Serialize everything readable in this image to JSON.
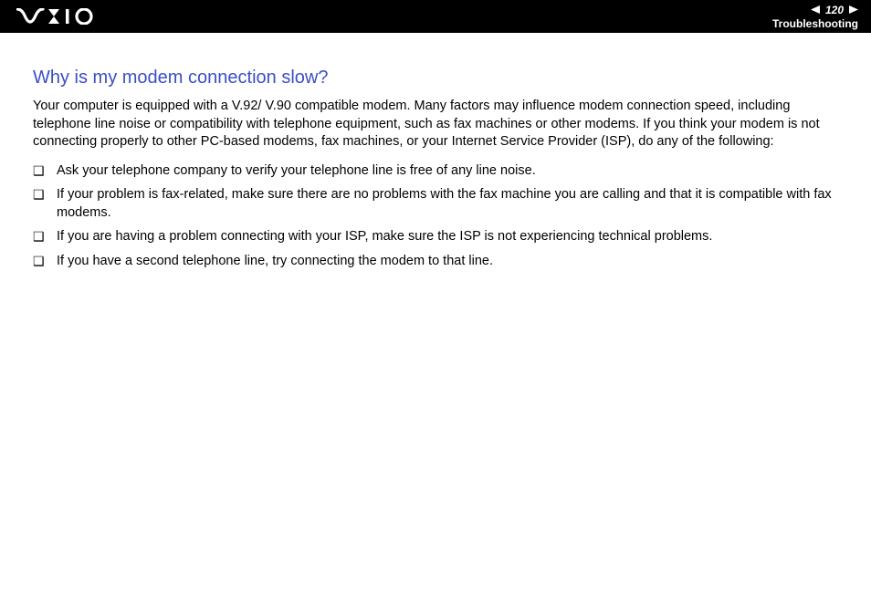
{
  "header": {
    "page_number": "120",
    "section": "Troubleshooting"
  },
  "content": {
    "heading": "Why is my modem connection slow?",
    "intro": "Your computer is equipped with a V.92/ V.90 compatible modem. Many factors may influence modem connection speed, including telephone line noise or compatibility with telephone equipment, such as fax machines or other modems. If you think your modem is not connecting properly to other PC-based modems, fax machines, or your Internet Service Provider (ISP), do any of the following:",
    "bullets": [
      "Ask your telephone company to verify your telephone line is free of any line noise.",
      "If your problem is fax-related, make sure there are no problems with the fax machine you are calling and that it is compatible with fax modems.",
      "If you are having a problem connecting with your ISP, make sure the ISP is not experiencing technical problems.",
      "If you have a second telephone line, try connecting the modem to that line."
    ]
  }
}
